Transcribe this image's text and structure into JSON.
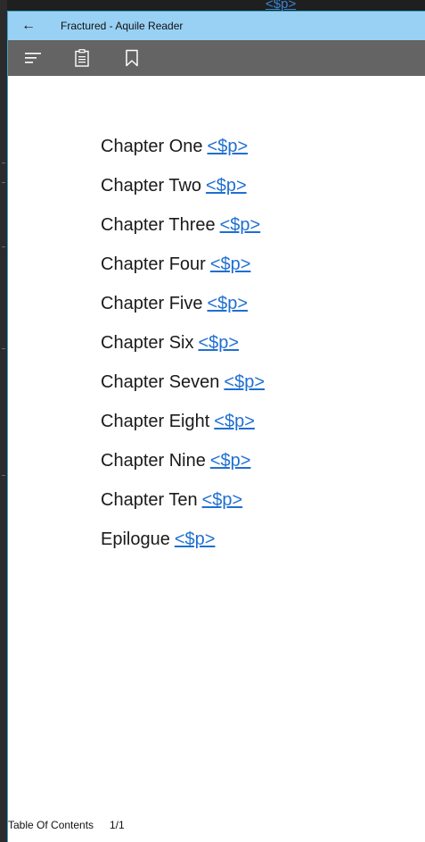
{
  "background": {
    "fragment_text": "<$p>"
  },
  "window": {
    "title": "Fractured - Aquile Reader",
    "back_glyph": "←"
  },
  "toolbar": {
    "items": [
      {
        "name": "menu-icon"
      },
      {
        "name": "notes-icon"
      },
      {
        "name": "bookmark-icon"
      }
    ]
  },
  "toc": {
    "items": [
      {
        "title": "Chapter One",
        "link": "<$p>"
      },
      {
        "title": "Chapter Two",
        "link": "<$p>"
      },
      {
        "title": "Chapter Three",
        "link": "<$p>"
      },
      {
        "title": "Chapter Four",
        "link": "<$p>"
      },
      {
        "title": "Chapter Five",
        "link": "<$p>"
      },
      {
        "title": "Chapter Six",
        "link": "<$p>"
      },
      {
        "title": "Chapter Seven",
        "link": "<$p>"
      },
      {
        "title": "Chapter Eight",
        "link": "<$p>"
      },
      {
        "title": "Chapter Nine",
        "link": "<$p>"
      },
      {
        "title": "Chapter Ten",
        "link": "<$p>"
      },
      {
        "title": "Epilogue",
        "link": "<$p>"
      }
    ]
  },
  "status": {
    "section": "Table Of Contents",
    "page": "1/1"
  },
  "colors": {
    "titlebar": "#99d1f5",
    "toolbar": "#646464",
    "link": "#1f6fd1"
  }
}
